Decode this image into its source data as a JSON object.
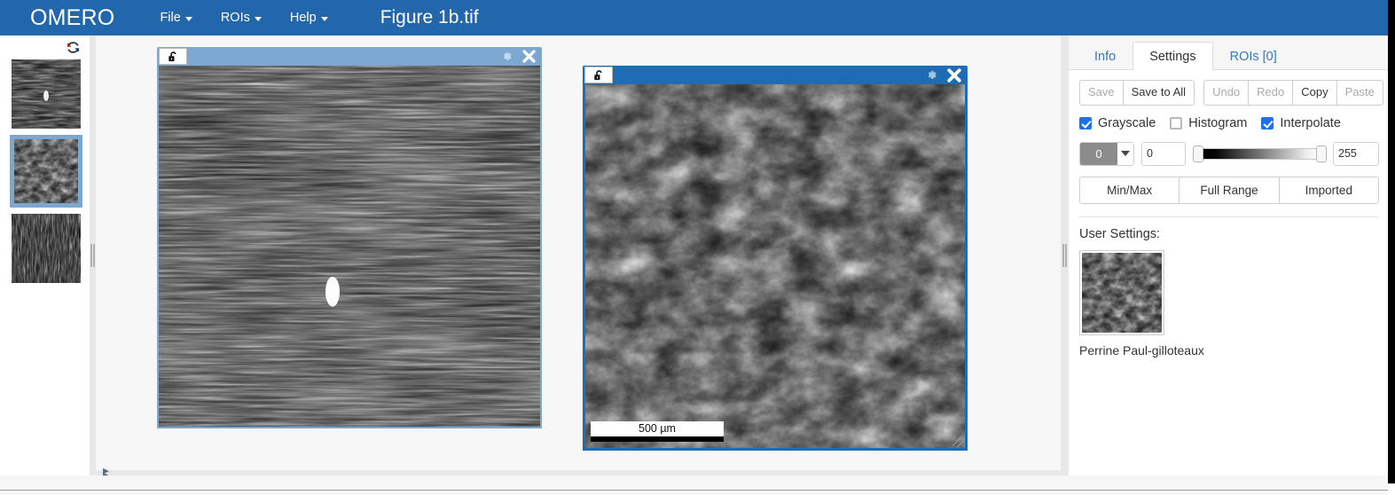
{
  "header": {
    "brand": "OMERO",
    "menus": [
      {
        "label": "File",
        "icon": "chevron-down-icon"
      },
      {
        "label": "ROIs",
        "icon": "chevron-down-icon"
      },
      {
        "label": "Help",
        "icon": "chevron-down-icon"
      }
    ],
    "document_title": "Figure 1b.tif",
    "background_color": "#2267ab"
  },
  "left_panel": {
    "refresh_icon": "refresh-icon",
    "thumbnails": [
      {
        "index": 0,
        "selected": false,
        "alt": "thumbnail-fibrous-tissue"
      },
      {
        "index": 1,
        "selected": true,
        "alt": "thumbnail-cobblestone-cells"
      },
      {
        "index": 2,
        "selected": false,
        "alt": "thumbnail-striated-texture"
      }
    ]
  },
  "viewport": {
    "windows": [
      {
        "id": "viewer-1",
        "active": false,
        "lock_icon": "unlocked-padlock-icon",
        "gear_icon": "gear-icon",
        "close_icon": "close-icon",
        "title_color": "#7ba7d0",
        "scalebar": null
      },
      {
        "id": "viewer-2",
        "active": true,
        "lock_icon": "unlocked-padlock-icon",
        "gear_icon": "gear-icon",
        "close_icon": "close-icon",
        "title_color": "#1d6cb4",
        "scalebar": {
          "label": "500 µm"
        },
        "resize_grip": "resize-grip-icon"
      }
    ]
  },
  "right_panel": {
    "tabs": [
      {
        "label": "Info",
        "active": false
      },
      {
        "label": "Settings",
        "active": true
      },
      {
        "label": "ROIs [0]",
        "active": false
      }
    ],
    "action_buttons_group_1": [
      {
        "label": "Save",
        "disabled": true
      },
      {
        "label": "Save to All",
        "disabled": false
      }
    ],
    "action_buttons_group_2": [
      {
        "label": "Undo",
        "disabled": true
      },
      {
        "label": "Redo",
        "disabled": true
      },
      {
        "label": "Copy",
        "disabled": false
      },
      {
        "label": "Paste",
        "disabled": true
      }
    ],
    "checkboxes": [
      {
        "label": "Grayscale",
        "checked": true
      },
      {
        "label": "Histogram",
        "checked": false
      },
      {
        "label": "Interpolate",
        "checked": true
      }
    ],
    "channel": {
      "selected": "0",
      "swatch_color": "#8c8c8c",
      "dropdown_icon": "chevron-down-icon"
    },
    "range": {
      "min_value": "0",
      "max_value": "255",
      "slider_min_label": "0",
      "slider_max_label": "255"
    },
    "range_buttons": [
      {
        "label": "Min/Max"
      },
      {
        "label": "Full Range"
      },
      {
        "label": "Imported"
      }
    ],
    "user_settings": {
      "label": "User Settings:",
      "owner": "Perrine Paul-gilloteaux",
      "thumbnail_alt": "user-settings-thumbnail"
    },
    "accent_color": "#1a73e8",
    "link_color": "#3778c2"
  }
}
